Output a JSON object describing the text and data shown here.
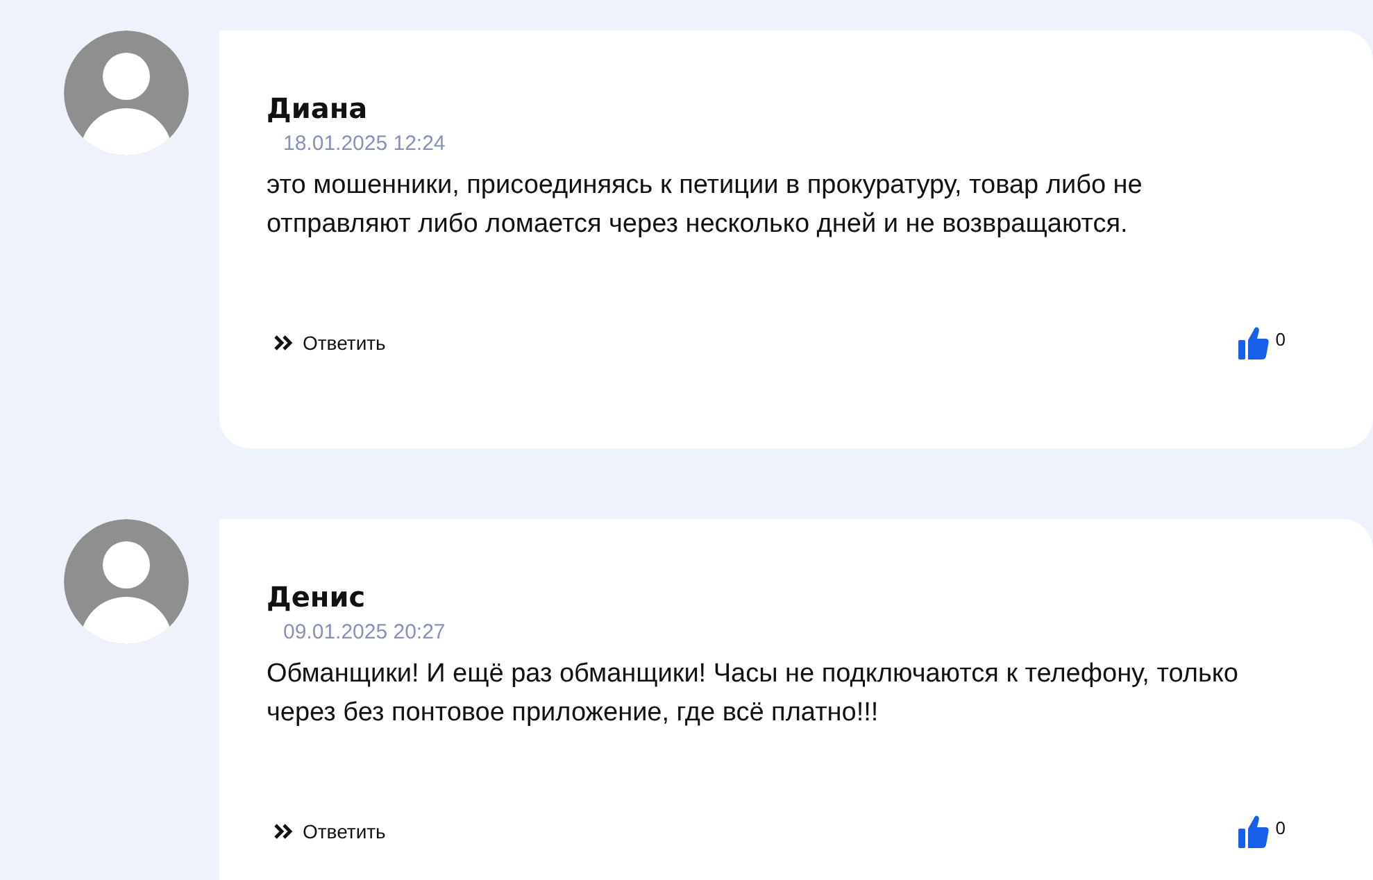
{
  "comments": [
    {
      "author": "Диана",
      "date": "18.01.2025 12:24",
      "text": "это мошенники, присоединяясь к петиции в прокуратуру, товар либо не отправляют либо ломается через несколько дней и не возвращаются.",
      "reply_label": "Ответить",
      "likes": "0"
    },
    {
      "author": "Денис",
      "date": "09.01.2025 20:27",
      "text": "Обманщики! И ещё раз обманщики! Часы не подключаются к телефону, только через без понтовое приложение, где всё платно!!!",
      "reply_label": "Ответить",
      "likes": "0"
    }
  ]
}
